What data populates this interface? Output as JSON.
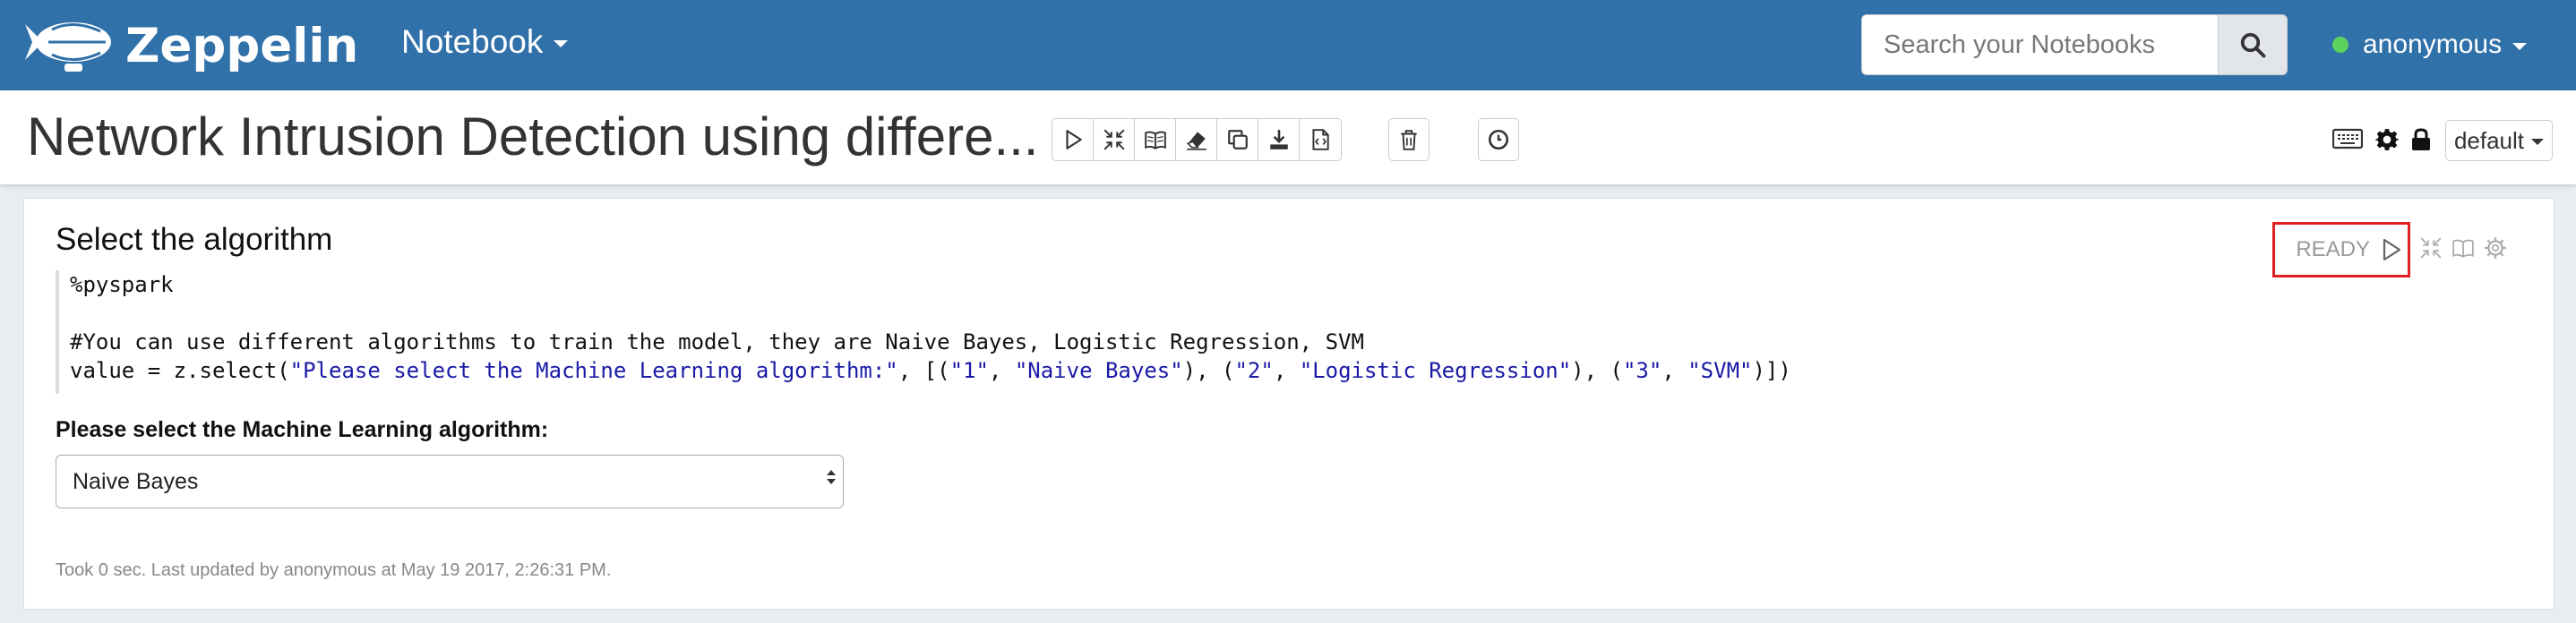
{
  "navbar": {
    "brand": "Zeppelin",
    "menu_label": "Notebook",
    "search_placeholder": "Search your Notebooks",
    "user": "anonymous",
    "status_color": "#5cd15c",
    "brand_color": "#3071a9"
  },
  "note": {
    "title": "Network Intrusion Detection using differe...",
    "toolbar_icons": [
      "run-all-icon",
      "hide-code-icon",
      "hide-output-icon",
      "clear-output-icon",
      "clone-icon",
      "export-icon",
      "version-control-icon",
      "trash-icon",
      "schedule-icon"
    ],
    "right_icons": [
      "keyboard-icon",
      "gear-icon",
      "lock-icon"
    ],
    "interpreter_binding": "default"
  },
  "paragraph": {
    "title": "Select the algorithm",
    "status": "READY",
    "code": {
      "line1": "%pyspark",
      "line2": "",
      "line3": "#You can use different algorithms to train the model, they are Naive Bayes, Logistic Regression, SVM",
      "line4_prefix": "value = z.select(",
      "line4_str1": "\"Please select the Machine Learning algorithm:\"",
      "line4_mid1": ", [(",
      "line4_str2": "\"1\"",
      "line4_mid2": ", ",
      "line4_str3": "\"Naive Bayes\"",
      "line4_mid3": "), (",
      "line4_str4": "\"2\"",
      "line4_mid4": ", ",
      "line4_str5": "\"Logistic Regression\"",
      "line4_mid5": "), (",
      "line4_str6": "\"3\"",
      "line4_mid6": ", ",
      "line4_str7": "\"SVM\"",
      "line4_suffix": ")])"
    },
    "form_label": "Please select the Machine Learning algorithm:",
    "select_value": "Naive Bayes",
    "footer": "Took 0 sec. Last updated by anonymous at May 19 2017, 2:26:31 PM."
  }
}
